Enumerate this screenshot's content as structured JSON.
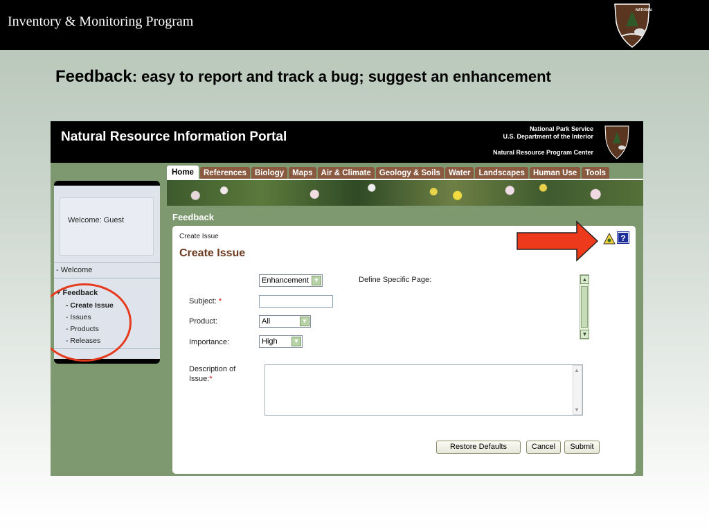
{
  "slide": {
    "title": "Inventory & Monitoring Program",
    "heading_strong": "Feedback",
    "heading_rest": ":  easy to report and track a bug; suggest an enhancement"
  },
  "portal": {
    "title": "Natural Resource Information Portal",
    "agency_line1": "National Park Service",
    "agency_line2": "U.S. Department of the Interior",
    "agency_line3": "Natural Resource Program Center",
    "tabs": [
      {
        "label": "Home"
      },
      {
        "label": "References"
      },
      {
        "label": "Biology"
      },
      {
        "label": "Maps"
      },
      {
        "label": "Air & Climate"
      },
      {
        "label": "Geology & Soils"
      },
      {
        "label": "Water"
      },
      {
        "label": "Landscapes"
      },
      {
        "label": "Human Use"
      },
      {
        "label": "Tools"
      }
    ],
    "active_tab": "Home",
    "section_label": "Feedback"
  },
  "sidebar": {
    "welcome": "Welcome: Guest",
    "items": [
      {
        "label": "- Welcome"
      },
      {
        "label": "+ Feedback"
      },
      {
        "label": "- Create Issue"
      },
      {
        "label": "- Issues"
      },
      {
        "label": "- Products"
      },
      {
        "label": "- Releases"
      }
    ]
  },
  "form": {
    "crumb": "Create Issue",
    "title": "Create Issue",
    "type_select": "Enhancement",
    "define_page_label": "Define Specific Page:",
    "subject_label": "Subject:",
    "required_mark": "*",
    "subject_value": "",
    "product_label": "Product:",
    "product_value": "All",
    "importance_label": "Importance:",
    "importance_value": "High",
    "description_label_1": "Description of",
    "description_label_2": "Issue:",
    "description_value": "",
    "buttons": {
      "restore": "Restore Defaults",
      "cancel": "Cancel",
      "submit": "Submit"
    },
    "help_label": "?"
  },
  "colors": {
    "accent_brown": "#6b3a20",
    "tab_brown": "#8a5a40",
    "portal_green": "#7e9970",
    "callout_red": "#e63a1e"
  }
}
